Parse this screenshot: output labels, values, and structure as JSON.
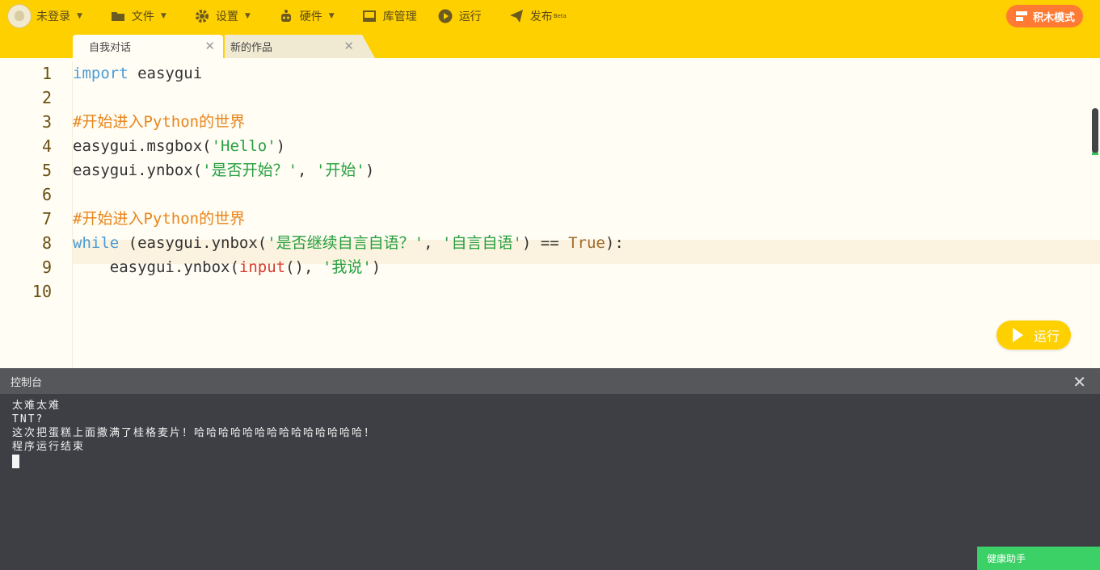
{
  "toolbar": {
    "login": "未登录",
    "file": "文件",
    "settings": "设置",
    "hardware": "硬件",
    "library": "库管理",
    "run": "运行",
    "publish": "发布",
    "publish_badge": "Beta",
    "block_mode": "积木模式"
  },
  "tabs": [
    {
      "label": "自我对话",
      "active": true
    },
    {
      "label": "新的作品",
      "active": false
    }
  ],
  "editor": {
    "line_numbers": [
      "1",
      "2",
      "3",
      "4",
      "5",
      "6",
      "7",
      "8",
      "9",
      "10"
    ],
    "run_label": "运行"
  },
  "code": {
    "l1_kw": "import",
    "l1_rest": " easygui",
    "l3": "#开始进入Python的世界",
    "l4_a": "easygui.msgbox(",
    "l4_s": "'Hello'",
    "l4_b": ")",
    "l5_a": "easygui.ynbox(",
    "l5_s1": "'是否开始？'",
    "l5_c": ", ",
    "l5_s2": "'开始'",
    "l5_b": ")",
    "l7": "#开始进入Python的世界",
    "l8_kw": "while",
    "l8_a": " (easygui.ynbox(",
    "l8_s1": "'是否继续自言自语？'",
    "l8_c": ", ",
    "l8_s2": "'自言自语'",
    "l8_b": ") == ",
    "l8_true": "True",
    "l8_end": "):",
    "l9_a": "    easygui.ynbox(",
    "l9_fn": "input",
    "l9_b": "(), ",
    "l9_s": "'我说'",
    "l9_end": ")"
  },
  "console": {
    "title": "控制台",
    "lines": [
      "太难太难",
      "TNT?",
      "这次把蛋糕上面撒满了桂格麦片！哈哈哈哈哈哈哈哈哈哈哈哈哈哈！",
      "程序运行结束"
    ]
  },
  "health_assistant": "健康助手",
  "colors": {
    "toolbar": "#ffd000",
    "block_mode": "#ff7a33",
    "console_bg": "#3d3f44",
    "health": "#3bd166"
  }
}
